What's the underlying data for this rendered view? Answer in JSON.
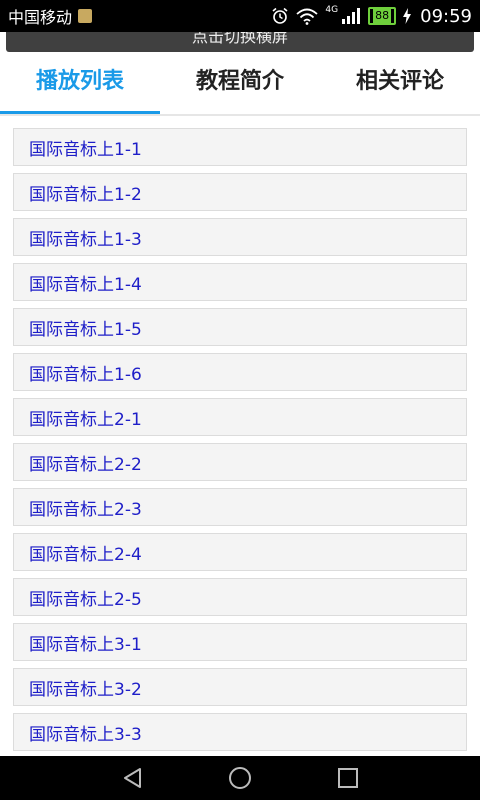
{
  "status_bar": {
    "carrier": "中国移动",
    "network_type": "4G",
    "battery": "88",
    "time": "09:59"
  },
  "rotate_button": {
    "label": "点击切换横屏"
  },
  "tabs": [
    {
      "label": "播放列表",
      "active": true
    },
    {
      "label": "教程简介",
      "active": false
    },
    {
      "label": "相关评论",
      "active": false
    }
  ],
  "playlist": [
    "国际音标上1-1",
    "国际音标上1-2",
    "国际音标上1-3",
    "国际音标上1-4",
    "国际音标上1-5",
    "国际音标上1-6",
    "国际音标上2-1",
    "国际音标上2-2",
    "国际音标上2-3",
    "国际音标上2-4",
    "国际音标上2-5",
    "国际音标上3-1",
    "国际音标上3-2",
    "国际音标上3-3"
  ],
  "colors": {
    "accent": "#1a9ae8",
    "item_text": "#1e1ec8",
    "item_bg": "#f4f4f4",
    "battery": "#6fcf3c"
  },
  "icons": {
    "back": "back-triangle-icon",
    "home": "home-circle-icon",
    "recents": "recents-square-icon"
  }
}
